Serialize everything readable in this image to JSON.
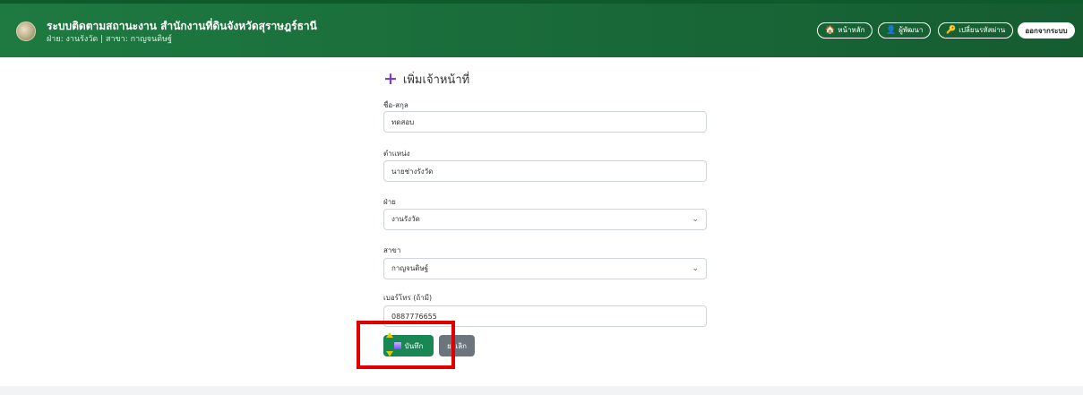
{
  "header": {
    "title": "ระบบติดตามสถานะงาน สำนักงานที่ดินจังหวัดสุราษฎร์ธานี",
    "subtitle": "ฝ่าย: งานรังวัด | สาขา: กาญจนดิษฐ์",
    "nav": [
      {
        "label": "หน้าหลัก",
        "icon": "home-icon"
      },
      {
        "label": "ผู้พัฒนา",
        "icon": "developer-icon"
      },
      {
        "label": "เปลี่ยนรหัสผ่าน",
        "icon": "key-icon"
      }
    ],
    "logout": "ออกจากระบบ"
  },
  "form": {
    "title": "เพิ่มเจ้าหน้าที่",
    "fields": [
      {
        "label": "ชื่อ-สกุล",
        "value": "ทดสอบ"
      },
      {
        "label": "ตำแหน่ง",
        "value": "นายช่างรังวัด"
      },
      {
        "label": "ฝ่าย",
        "value": "งานรังวัด"
      },
      {
        "label": "สาขา",
        "value": "กาญจนดิษฐ์"
      },
      {
        "label": "เบอร์โทร (ถ้ามี)",
        "value": "0887776655"
      }
    ],
    "save_label": "บันทึก",
    "cancel_label": "ยกเลิก"
  },
  "colors": {
    "header_bg": "#1e7a41",
    "save_button": "#198754",
    "cancel_button": "#6c757d",
    "highlight": "#e00000",
    "plus_icon": "#7a3fc4"
  }
}
